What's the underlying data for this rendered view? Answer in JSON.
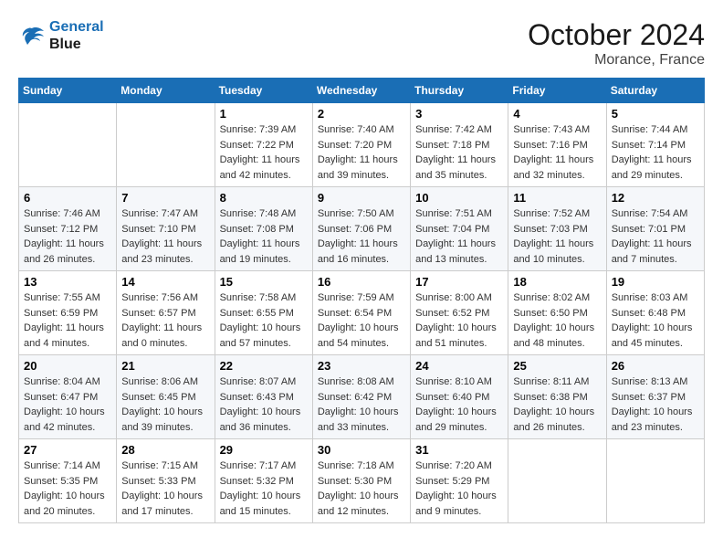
{
  "header": {
    "logo_line1": "General",
    "logo_line2": "Blue",
    "month_title": "October 2024",
    "location": "Morance, France"
  },
  "weekdays": [
    "Sunday",
    "Monday",
    "Tuesday",
    "Wednesday",
    "Thursday",
    "Friday",
    "Saturday"
  ],
  "weeks": [
    [
      {
        "day": "",
        "info": ""
      },
      {
        "day": "",
        "info": ""
      },
      {
        "day": "1",
        "info": "Sunrise: 7:39 AM\nSunset: 7:22 PM\nDaylight: 11 hours and 42 minutes."
      },
      {
        "day": "2",
        "info": "Sunrise: 7:40 AM\nSunset: 7:20 PM\nDaylight: 11 hours and 39 minutes."
      },
      {
        "day": "3",
        "info": "Sunrise: 7:42 AM\nSunset: 7:18 PM\nDaylight: 11 hours and 35 minutes."
      },
      {
        "day": "4",
        "info": "Sunrise: 7:43 AM\nSunset: 7:16 PM\nDaylight: 11 hours and 32 minutes."
      },
      {
        "day": "5",
        "info": "Sunrise: 7:44 AM\nSunset: 7:14 PM\nDaylight: 11 hours and 29 minutes."
      }
    ],
    [
      {
        "day": "6",
        "info": "Sunrise: 7:46 AM\nSunset: 7:12 PM\nDaylight: 11 hours and 26 minutes."
      },
      {
        "day": "7",
        "info": "Sunrise: 7:47 AM\nSunset: 7:10 PM\nDaylight: 11 hours and 23 minutes."
      },
      {
        "day": "8",
        "info": "Sunrise: 7:48 AM\nSunset: 7:08 PM\nDaylight: 11 hours and 19 minutes."
      },
      {
        "day": "9",
        "info": "Sunrise: 7:50 AM\nSunset: 7:06 PM\nDaylight: 11 hours and 16 minutes."
      },
      {
        "day": "10",
        "info": "Sunrise: 7:51 AM\nSunset: 7:04 PM\nDaylight: 11 hours and 13 minutes."
      },
      {
        "day": "11",
        "info": "Sunrise: 7:52 AM\nSunset: 7:03 PM\nDaylight: 11 hours and 10 minutes."
      },
      {
        "day": "12",
        "info": "Sunrise: 7:54 AM\nSunset: 7:01 PM\nDaylight: 11 hours and 7 minutes."
      }
    ],
    [
      {
        "day": "13",
        "info": "Sunrise: 7:55 AM\nSunset: 6:59 PM\nDaylight: 11 hours and 4 minutes."
      },
      {
        "day": "14",
        "info": "Sunrise: 7:56 AM\nSunset: 6:57 PM\nDaylight: 11 hours and 0 minutes."
      },
      {
        "day": "15",
        "info": "Sunrise: 7:58 AM\nSunset: 6:55 PM\nDaylight: 10 hours and 57 minutes."
      },
      {
        "day": "16",
        "info": "Sunrise: 7:59 AM\nSunset: 6:54 PM\nDaylight: 10 hours and 54 minutes."
      },
      {
        "day": "17",
        "info": "Sunrise: 8:00 AM\nSunset: 6:52 PM\nDaylight: 10 hours and 51 minutes."
      },
      {
        "day": "18",
        "info": "Sunrise: 8:02 AM\nSunset: 6:50 PM\nDaylight: 10 hours and 48 minutes."
      },
      {
        "day": "19",
        "info": "Sunrise: 8:03 AM\nSunset: 6:48 PM\nDaylight: 10 hours and 45 minutes."
      }
    ],
    [
      {
        "day": "20",
        "info": "Sunrise: 8:04 AM\nSunset: 6:47 PM\nDaylight: 10 hours and 42 minutes."
      },
      {
        "day": "21",
        "info": "Sunrise: 8:06 AM\nSunset: 6:45 PM\nDaylight: 10 hours and 39 minutes."
      },
      {
        "day": "22",
        "info": "Sunrise: 8:07 AM\nSunset: 6:43 PM\nDaylight: 10 hours and 36 minutes."
      },
      {
        "day": "23",
        "info": "Sunrise: 8:08 AM\nSunset: 6:42 PM\nDaylight: 10 hours and 33 minutes."
      },
      {
        "day": "24",
        "info": "Sunrise: 8:10 AM\nSunset: 6:40 PM\nDaylight: 10 hours and 29 minutes."
      },
      {
        "day": "25",
        "info": "Sunrise: 8:11 AM\nSunset: 6:38 PM\nDaylight: 10 hours and 26 minutes."
      },
      {
        "day": "26",
        "info": "Sunrise: 8:13 AM\nSunset: 6:37 PM\nDaylight: 10 hours and 23 minutes."
      }
    ],
    [
      {
        "day": "27",
        "info": "Sunrise: 7:14 AM\nSunset: 5:35 PM\nDaylight: 10 hours and 20 minutes."
      },
      {
        "day": "28",
        "info": "Sunrise: 7:15 AM\nSunset: 5:33 PM\nDaylight: 10 hours and 17 minutes."
      },
      {
        "day": "29",
        "info": "Sunrise: 7:17 AM\nSunset: 5:32 PM\nDaylight: 10 hours and 15 minutes."
      },
      {
        "day": "30",
        "info": "Sunrise: 7:18 AM\nSunset: 5:30 PM\nDaylight: 10 hours and 12 minutes."
      },
      {
        "day": "31",
        "info": "Sunrise: 7:20 AM\nSunset: 5:29 PM\nDaylight: 10 hours and 9 minutes."
      },
      {
        "day": "",
        "info": ""
      },
      {
        "day": "",
        "info": ""
      }
    ]
  ]
}
